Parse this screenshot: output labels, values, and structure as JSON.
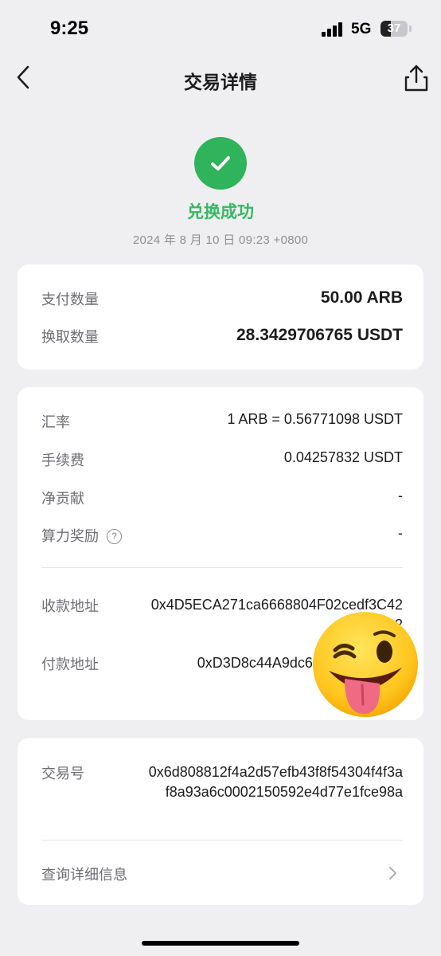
{
  "status_bar": {
    "time": "9:25",
    "network": "5G",
    "battery": "37",
    "battery_level": 0.37
  },
  "nav": {
    "title": "交易详情",
    "back_icon": "chevron-left-icon",
    "share_icon": "share-icon"
  },
  "hero": {
    "icon": "check-circle-icon",
    "status": "兑换成功",
    "timestamp": "2024 年 8 月 10 日 09:23 +0800",
    "accent": "#2fb35b"
  },
  "amounts": {
    "pay": {
      "label": "支付数量",
      "value": "50.00 ARB"
    },
    "receive": {
      "label": "换取数量",
      "value": "28.3429706765 USDT"
    }
  },
  "details": {
    "rate": {
      "label": "汇率",
      "value": "1 ARB = 0.56771098 USDT"
    },
    "fee": {
      "label": "手续费",
      "value": "0.04257832 USDT"
    },
    "net": {
      "label": "净贡献",
      "value": "-"
    },
    "reward": {
      "label": "算力奖励",
      "value": "-",
      "icon": "help-circle-icon"
    },
    "to_address": {
      "label": "收款地址",
      "value": "0x4D5ECA271ca6668804F02cedf3C423b82"
    },
    "from_address": {
      "label": "付款地址",
      "value": "0xD3D8c44A9dc669eCe373763"
    }
  },
  "tx": {
    "hash": {
      "label": "交易号",
      "value": "0x6d808812f4a2d57efb43f8f54304f4f3af8a93a6c0002150592e4d77e1fce98a"
    },
    "view_more": {
      "label": "查询详细信息",
      "icon": "chevron-right-icon"
    }
  }
}
